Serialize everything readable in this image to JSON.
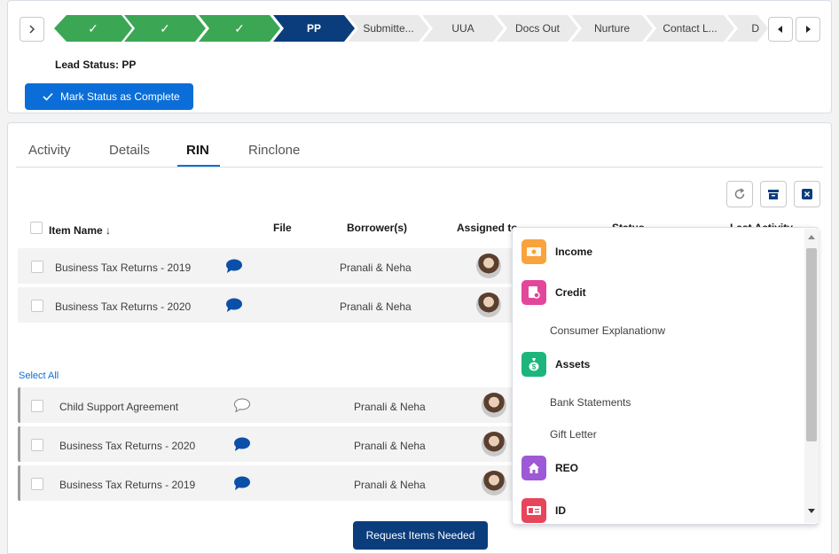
{
  "path": {
    "prev_icon": "chevron-right-icon",
    "steps": [
      {
        "label": "✓",
        "state": "complete"
      },
      {
        "label": "✓",
        "state": "complete"
      },
      {
        "label": "✓",
        "state": "complete"
      },
      {
        "label": "PP",
        "state": "current"
      },
      {
        "label": "Submitte...",
        "state": "incomplete"
      },
      {
        "label": "UUA",
        "state": "incomplete"
      },
      {
        "label": "Docs Out",
        "state": "incomplete"
      },
      {
        "label": "Nurture",
        "state": "incomplete"
      },
      {
        "label": "Contact L...",
        "state": "incomplete"
      },
      {
        "label": "D",
        "state": "incomplete"
      }
    ],
    "scroll_left_icon": "triangle-left-icon",
    "scroll_right_icon": "triangle-right-icon"
  },
  "lead_status": "Lead Status: PP",
  "mark_complete_label": "Mark Status as Complete",
  "tabs": [
    {
      "label": "Activity"
    },
    {
      "label": "Details"
    },
    {
      "label": "RIN",
      "active": true
    },
    {
      "label": "Rinclone"
    }
  ],
  "toolbar": {
    "refresh_icon": "refresh-icon",
    "archive_icon": "archive-icon",
    "close_icon": "close-icon"
  },
  "table": {
    "headers": {
      "item_name": "Item Name ↓",
      "file": "File",
      "borrowers": "Borrower(s)",
      "assigned_to": "Assigned to",
      "status": "Status",
      "last_activity": "Last Activity"
    },
    "upper_rows": [
      {
        "name": "Business Tax Returns - 2019",
        "file_icon": "comment-filled-icon",
        "borrowers": "Pranali & Neha"
      },
      {
        "name": "Business Tax Returns - 2020",
        "file_icon": "comment-filled-icon",
        "borrowers": "Pranali & Neha"
      }
    ],
    "select_all": "Select All",
    "lower_rows": [
      {
        "name": "Child Support Agreement",
        "file_icon": "comment-outline-icon",
        "borrowers": "Pranali & Neha"
      },
      {
        "name": "Business Tax Returns - 2020",
        "file_icon": "comment-filled-icon",
        "borrowers": "Pranali & Neha"
      },
      {
        "name": "Business Tax Returns - 2019",
        "file_icon": "comment-filled-icon",
        "borrowers": "Pranali & Neha"
      }
    ]
  },
  "request_button": "Request Items Needed",
  "dropdown": {
    "entries": [
      {
        "type": "category",
        "label": "Income",
        "icon": "money-icon",
        "color": "#f9a33c"
      },
      {
        "type": "category",
        "label": "Credit",
        "icon": "credit-report-icon",
        "color": "#e3479b"
      },
      {
        "type": "item",
        "label": "Consumer Explanationw"
      },
      {
        "type": "category",
        "label": "Assets",
        "icon": "money-bag-icon",
        "color": "#1cb57b"
      },
      {
        "type": "item",
        "label": "Bank Statements"
      },
      {
        "type": "item",
        "label": "Gift Letter"
      },
      {
        "type": "category",
        "label": "REO",
        "icon": "house-icon",
        "color": "#9d59d6"
      },
      {
        "type": "category",
        "label": "ID",
        "icon": "id-card-icon",
        "color": "#e8455a"
      }
    ]
  },
  "colors": {
    "complete": "#3ba755",
    "current": "#0b3d7c",
    "brand_blue": "#0b6ed8"
  }
}
